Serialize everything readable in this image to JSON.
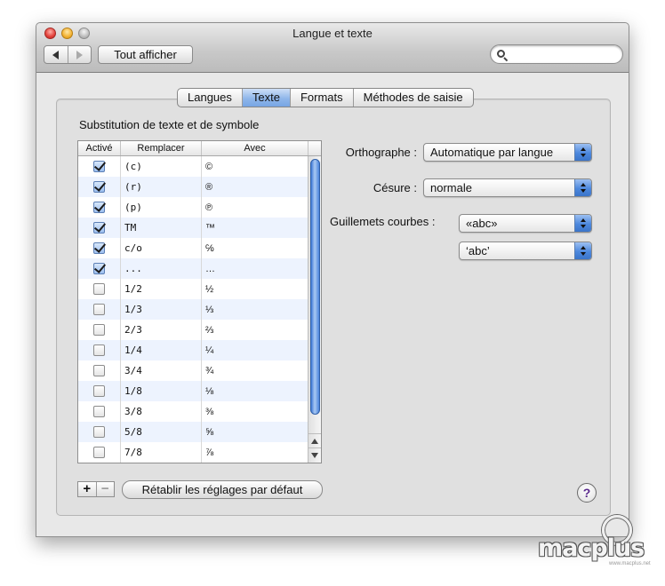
{
  "window": {
    "title": "Langue et texte",
    "show_all_label": "Tout afficher",
    "search_placeholder": ""
  },
  "tabs": [
    {
      "label": "Langues",
      "active": false
    },
    {
      "label": "Texte",
      "active": true
    },
    {
      "label": "Formats",
      "active": false
    },
    {
      "label": "Méthodes de saisie",
      "active": false
    }
  ],
  "substitution": {
    "section_title": "Substitution de texte et de symbole",
    "columns": [
      "Activé",
      "Remplacer",
      "Avec"
    ],
    "rows": [
      {
        "enabled": true,
        "replace": "(c)",
        "with": "©"
      },
      {
        "enabled": true,
        "replace": "(r)",
        "with": "®"
      },
      {
        "enabled": true,
        "replace": "(p)",
        "with": "℗"
      },
      {
        "enabled": true,
        "replace": "TM",
        "with": "™"
      },
      {
        "enabled": true,
        "replace": "c/o",
        "with": "℅"
      },
      {
        "enabled": true,
        "replace": "...",
        "with": "…"
      },
      {
        "enabled": false,
        "replace": "1/2",
        "with": "½"
      },
      {
        "enabled": false,
        "replace": "1/3",
        "with": "⅓"
      },
      {
        "enabled": false,
        "replace": "2/3",
        "with": "⅔"
      },
      {
        "enabled": false,
        "replace": "1/4",
        "with": "¼"
      },
      {
        "enabled": false,
        "replace": "3/4",
        "with": "¾"
      },
      {
        "enabled": false,
        "replace": "1/8",
        "with": "⅛"
      },
      {
        "enabled": false,
        "replace": "3/8",
        "with": "⅜"
      },
      {
        "enabled": false,
        "replace": "5/8",
        "with": "⅝"
      },
      {
        "enabled": false,
        "replace": "7/8",
        "with": "⅞"
      }
    ],
    "add_label": "+",
    "remove_label": "−",
    "restore_label": "Rétablir les réglages par défaut"
  },
  "options": {
    "spelling_label": "Orthographe :",
    "spelling_value": "Automatique par langue",
    "hyphenation_label": "Césure :",
    "hyphenation_value": "normale",
    "quotes_label": "Guillemets courbes :",
    "double_quotes_value": "«abc»",
    "single_quotes_value": "‘abc’"
  },
  "help_label": "?",
  "watermark": {
    "brand": "macplus",
    "site": "www.macplus.net"
  },
  "icons": {
    "back": "chevron-left-icon",
    "forward": "chevron-right-icon",
    "search": "magnifier-icon"
  }
}
